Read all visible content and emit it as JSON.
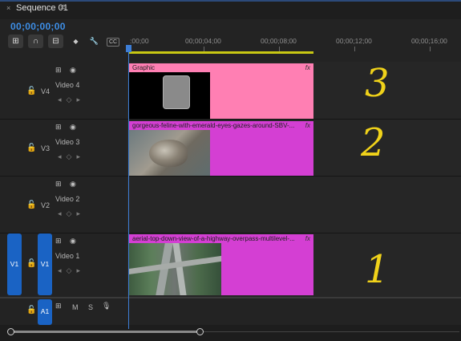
{
  "sequence": {
    "close": "×",
    "title": "Sequence 01",
    "menu": "≡"
  },
  "timecode": "00;00;00;00",
  "toolbar": [
    {
      "name": "insert-overwrite-icon",
      "glyph": "⊞"
    },
    {
      "name": "snap-icon",
      "glyph": "∩"
    },
    {
      "name": "linked-selection-icon",
      "glyph": "⊟"
    },
    {
      "name": "add-marker-icon",
      "glyph": "◆"
    },
    {
      "name": "wrench-icon",
      "glyph": "🔧"
    },
    {
      "name": "captions-icon",
      "glyph": "CC"
    }
  ],
  "ruler": [
    ":00;00",
    "00;00;04;00",
    "00;00;08;00",
    "00;00;12;00",
    "00;00;16;00"
  ],
  "tracks": {
    "v4": {
      "id": "V4",
      "name": "Video 4"
    },
    "v3": {
      "id": "V3",
      "name": "Video 3"
    },
    "v2": {
      "id": "V2",
      "name": "Video 2"
    },
    "v1": {
      "id": "V1",
      "name": "Video 1",
      "source": "V1"
    },
    "a1": {
      "id": "A1",
      "m": "M",
      "s": "S"
    }
  },
  "clips": {
    "graphic": {
      "title": "Graphic",
      "fx": "fx",
      "color": "#ff7fb3"
    },
    "cat": {
      "title": "gorgeous-feline-with-emerald-eyes-gazes-around-SBV-...",
      "fx": "fx",
      "color": "#d43fd3"
    },
    "highway": {
      "title": "aerial-top-down-view-of-a-highway-overpass-multilevel-...",
      "fx": "fx",
      "color": "#d43fd3"
    }
  },
  "annotations": {
    "three": "3",
    "two": "2",
    "one": "1"
  }
}
